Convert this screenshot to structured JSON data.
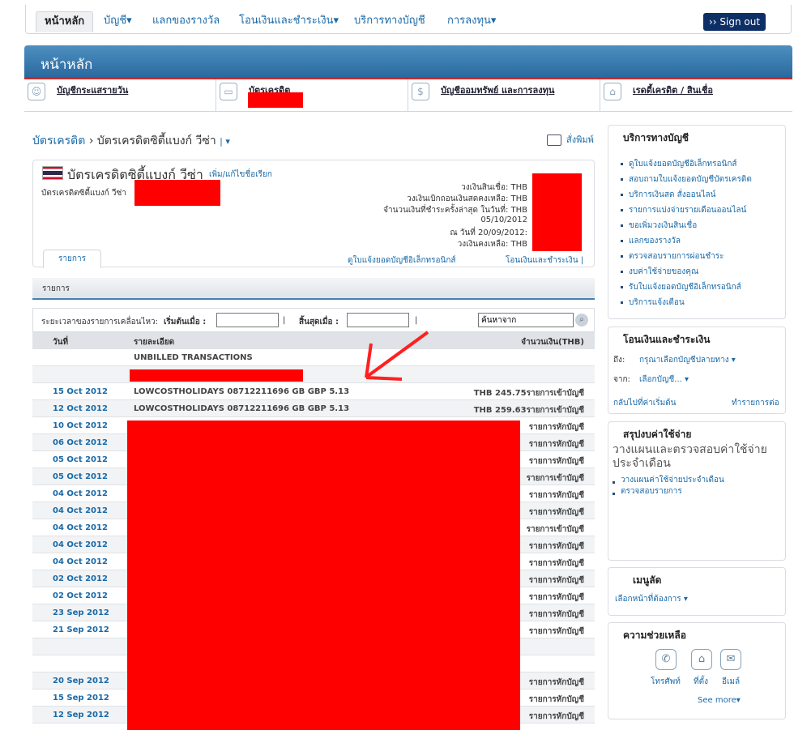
{
  "topnav": {
    "tabs": [
      "หน้าหลัก",
      "บัญชี▾",
      "แลกของรางวัล",
      "โอนเงินและชำระเงิน▾",
      "บริการทางบัญชี",
      "การลงทุน▾"
    ],
    "signout": "›› Sign out"
  },
  "banner": {
    "title": "หน้าหลัก"
  },
  "categories": [
    {
      "label": "บัญชีกระแสรายวัน",
      "icon": "person-icon"
    },
    {
      "label": "บัตรเครดิต",
      "icon": "credit-card-icon"
    },
    {
      "label": "บัญชีออมทรัพย์ และการลงทุน",
      "icon": "money-icon"
    },
    {
      "label": "เรดดี้เครดิต / สินเชื่อ",
      "icon": "home-loan-icon"
    }
  ],
  "breadcrumb": {
    "home": "บัตรเครดิต",
    "sep": "›",
    "current": "บัตรเครดิตซิตี้แบงก์ วีซ่า",
    "dropdown": "| ▾"
  },
  "print_label": "สั่งพิมพ์",
  "account": {
    "name": "บัตรเครดิตซิตี้แบงก์ วีซ่า",
    "edit_link": "เพิ่ม/แก้ไขชื่อเรียก",
    "sub_label": "บัตรเครดิตซิตี้แบงก์ วีซ่า",
    "balances": [
      "วงเงินสินเชื่อ: THB",
      "วงเงินเบิกถอนเงินสดคงเหลือ: THB",
      "จำนวนเงินที่ชำระครั้งล่าสุด ในวันที่: THB",
      "05/10/2012",
      "ณ วันที่ 20/09/2012:",
      "วงเงินคงเหลือ: THB"
    ],
    "tab": "รายการ",
    "link_statement": "ดูใบแจ้งยอดบัญชีอิเล็กทรอนิกส์",
    "link_transfer": "โอนเงินและชำระเงิน |"
  },
  "list_header": "รายการ",
  "filter": {
    "label": "ระยะเวลาของรายการเคลื่อนไหว:",
    "from_label": "เริ่มต้นเมื่อ :",
    "to_label": "สิ้นสุดเมื่อ :",
    "sep": "|",
    "search_value": "ค้นหาจาก"
  },
  "table": {
    "headers": [
      "วันที่",
      "รายละเอียด",
      "จำนวนเงิน(THB)"
    ],
    "rows": [
      {
        "date": "",
        "desc": "UNBILLED TRANSACTIONS",
        "amount": ""
      },
      {
        "date": "",
        "desc": "",
        "amount": ""
      },
      {
        "date": "15 Oct 2012",
        "desc": "LOWCOSTHOLIDAYS 08712211696 GB GBP 5.13",
        "amount": "THB 245.75รายการเข้าบัญชี"
      },
      {
        "date": "12 Oct 2012",
        "desc": "LOWCOSTHOLIDAYS 08712211696 GB GBP 5.13",
        "amount": "THB 259.63รายการเข้าบัญชี"
      },
      {
        "date": "10 Oct 2012",
        "desc": "",
        "amount": "รายการหักบัญชี"
      },
      {
        "date": "06 Oct 2012",
        "desc": "",
        "amount": "รายการหักบัญชี"
      },
      {
        "date": "05 Oct 2012",
        "desc": "",
        "amount": "รายการหักบัญชี"
      },
      {
        "date": "05 Oct 2012",
        "desc": "",
        "amount": "รายการเข้าบัญชี"
      },
      {
        "date": "04 Oct 2012",
        "desc": "",
        "amount": "รายการหักบัญชี"
      },
      {
        "date": "04 Oct 2012",
        "desc": "",
        "amount": "รายการหักบัญชี"
      },
      {
        "date": "04 Oct 2012",
        "desc": "",
        "amount": "รายการเข้าบัญชี"
      },
      {
        "date": "04 Oct 2012",
        "desc": "",
        "amount": "รายการหักบัญชี"
      },
      {
        "date": "04 Oct 2012",
        "desc": "",
        "amount": "รายการหักบัญชี"
      },
      {
        "date": "02 Oct 2012",
        "desc": "",
        "amount": "รายการหักบัญชี"
      },
      {
        "date": "02 Oct 2012",
        "desc": "",
        "amount": "รายการหักบัญชี"
      },
      {
        "date": "23 Sep 2012",
        "desc": "",
        "amount": "รายการหักบัญชี"
      },
      {
        "date": "21 Sep 2012",
        "desc": "",
        "amount": "รายการหักบัญชี"
      },
      {
        "date": "",
        "desc": "",
        "amount": ""
      },
      {
        "date": "",
        "desc": "",
        "amount": ""
      },
      {
        "date": "20 Sep 2012",
        "desc": "",
        "amount": "รายการหักบัญชี"
      },
      {
        "date": "15 Sep 2012",
        "desc": "",
        "amount": "รายการหักบัญชี"
      },
      {
        "date": "12 Sep 2012",
        "desc": "",
        "amount": "รายการหักบัญชี"
      }
    ]
  },
  "sidebar": {
    "services": {
      "title": "บริการทางบัญชี",
      "items": [
        "ดูใบแจ้งยอดบัญชีอิเล็กทรอนิกส์",
        "สอบถามใบแจ้งยอดบัญชีบัตรเครดิต",
        "บริการเงินสด สั่งออนไลน์",
        "รายการแบ่งจ่ายรายเดือนออนไลน์",
        "ขอเพิ่มวงเงินสินเชื่อ",
        "แลกของรางวัล",
        "ตรวจสอบรายการผ่อนชำระ",
        "งบค่าใช้จ่ายของคุณ",
        "รับใบแจ้งยอดบัญชีอิเล็กทรอนิกส์",
        "บริการแจ้งเตือน"
      ]
    },
    "transfer": {
      "title": "โอนเงินและชำระเงิน",
      "to_label": "ถึง:",
      "to_select": "กรุณาเลือกบัญชีปลายทาง ▾",
      "from_label": "จาก:",
      "from_select": "เลือกบัญชี... ▾",
      "reset": "กลับไปที่ค่าเริ่มต้น",
      "go": "ทำรายการต่อ"
    },
    "expenses": {
      "title": "สรุปงบค่าใช้จ่าย",
      "big_text": "วางแผนและตรวจสอบค่าใช้จ่ายประจำเดือน",
      "items": [
        "วางแผนค่าใช้จ่ายประจำเดือน",
        "ตรวจสอบรายการ"
      ]
    },
    "shortcut": {
      "title": "เมนูลัด",
      "select": "เลือกหน้าที่ต้องการ ▾"
    },
    "help": {
      "title": "ความช่วยเหลือ",
      "items": [
        {
          "label": "โทรศัพท์",
          "icon": "phone-icon"
        },
        {
          "label": "ที่ตั้ง",
          "icon": "location-icon"
        },
        {
          "label": "อีเมล์",
          "icon": "email-icon"
        }
      ],
      "see_more": "See more▾"
    }
  }
}
